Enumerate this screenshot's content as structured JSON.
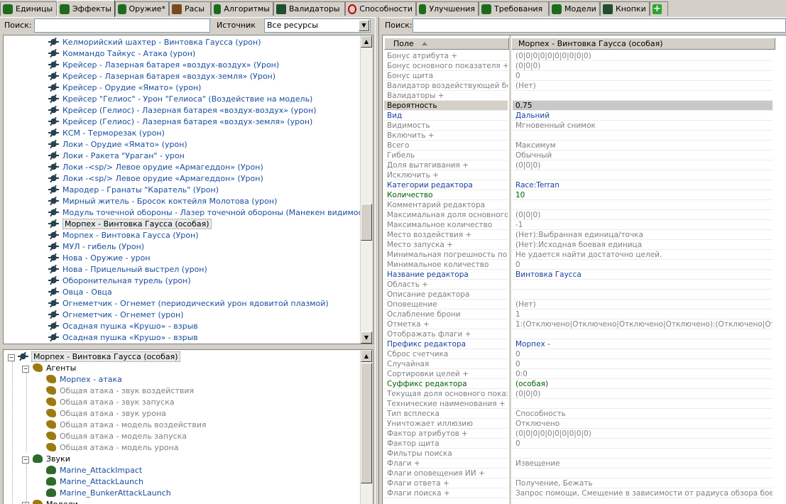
{
  "tabs": [
    {
      "label": "Единицы",
      "icon": "unit-icon"
    },
    {
      "label": "Эффекты",
      "icon": "effect-icon"
    },
    {
      "label": "Оружие*",
      "icon": "weapon-icon"
    },
    {
      "label": "Расы",
      "icon": "race-icon"
    },
    {
      "label": "Алгоритмы",
      "icon": "behavior-icon"
    },
    {
      "label": "Валидаторы",
      "icon": "validator-icon"
    },
    {
      "label": "Способности",
      "icon": "ability-icon"
    },
    {
      "label": "Улучшения",
      "icon": "upgrade-icon"
    },
    {
      "label": "Требования",
      "icon": "requirement-icon"
    },
    {
      "label": "Модели",
      "icon": "model-icon"
    },
    {
      "label": "Кнопки",
      "icon": "button-icon"
    },
    {
      "label": "",
      "icon": "add-tab-icon"
    }
  ],
  "left_search": {
    "label": "Поиск:",
    "value": ""
  },
  "source": {
    "label": "Источник",
    "value": "Все ресурсы"
  },
  "right_search": {
    "label": "Поиск:",
    "value": ""
  },
  "effect_list": [
    "Келморийский шахтер - Винтовка Гаусса (урон)",
    "Коммандо Тайкус - Атака (урон)",
    "Крейсер - Лазерная батарея «воздух-воздух» (Урон)",
    "Крейсер - Лазерная батарея «воздух-земля» (Урон)",
    "Крейсер - Орудие «Ямато» (урон)",
    "Крейсер \"Гелиос\" - Урон \"Гелиоса\" (Воздействие на модель)",
    "Крейсер (Гелиос) - Лазерная батарея «воздух-воздух» (урон)",
    "Крейсер (Гелиос) - Лазерная батарея «воздух-земля» (урон)",
    "КСМ - Терморезак (урон)",
    "Локи - Орудие «Ямато» (урон)",
    "Локи - Ракета \"Ураган\" - урон",
    "Локи -<sp/> Левое орудие «Армагеддон» (Урон)",
    "Локи -<sp/> Левое орудие «Армагеддон» (Урон)",
    "Мародер - Гранаты \"Каратель\" (Урон)",
    "Мирный житель - Бросок коктейля Молотова (урон)",
    "Модуль точечной обороны - Лазер точечной обороны (Манекен видимости)",
    "Морпех - Винтовка Гаусса (особая)",
    "Морпех - Винтовка Гаусса (Урон)",
    "МУЛ - гибель (Урон)",
    "Нова - Оружие - урон",
    "Нова - Прицельный выстрел (урон)",
    "Оборонительная турель (урон)",
    "Овца - Овца",
    "Огнеметчик - Огнемет (периодический урон ядовитой плазмой)",
    "Огнеметчик - Огнемет (урон)",
    "Осадная пушка «Крушо» - взрыв",
    "Осадная пушка «Крушо» - взрыв"
  ],
  "selected_effect_index": 16,
  "tree": {
    "root": "Морпех - Винтовка Гаусса (особая)",
    "agents_label": "Агенты",
    "agents": [
      {
        "label": "Морпех - атака",
        "active": true
      },
      {
        "label": "Общая атака - звук воздействия",
        "active": false
      },
      {
        "label": "Общая атака - звук запуска",
        "active": false
      },
      {
        "label": "Общая атака - звук урона",
        "active": false
      },
      {
        "label": "Общая атака - модель воздействия",
        "active": false
      },
      {
        "label": "Общая атака - модель запуска",
        "active": false
      },
      {
        "label": "Общая атака - модель урона",
        "active": false
      }
    ],
    "sounds_label": "Звуки",
    "sounds": [
      "Marine_AttackImpact",
      "Marine_AttackLaunch",
      "Marine_BunkerAttackLaunch"
    ],
    "models_label": "Модели"
  },
  "grid": {
    "col_field": "Поле",
    "col_value": "Морпех - Винтовка Гаусса (особая)",
    "rows": [
      {
        "name": "Бонус атрибута +",
        "value": "(0|0|0|0|0|0|0|0|0|0)",
        "style": "grey"
      },
      {
        "name": "Бонус основного показателя +",
        "value": "(0|0|0)",
        "style": "grey"
      },
      {
        "name": "Бонус щита",
        "value": "0",
        "style": "grey"
      },
      {
        "name": "Валидатор воздействующей боевой единицы",
        "value": "(Нет)",
        "style": "grey"
      },
      {
        "name": "Валидаторы +",
        "value": "",
        "style": "grey"
      },
      {
        "name": "Вероятность",
        "value": "0.75",
        "style": "hl"
      },
      {
        "name": "Вид",
        "value": "Дальний",
        "style": "blue"
      },
      {
        "name": "Видимость",
        "value": "Мгновенный снимок",
        "style": "grey"
      },
      {
        "name": "Включить +",
        "value": "",
        "style": "grey"
      },
      {
        "name": "Всего",
        "value": "Максимум",
        "style": "grey"
      },
      {
        "name": "Гибель",
        "value": "Обычный",
        "style": "grey"
      },
      {
        "name": "Доля вытягивания +",
        "value": "(0|0|0)",
        "style": "grey"
      },
      {
        "name": "Исключить +",
        "value": "",
        "style": "grey"
      },
      {
        "name": "Категории редактора",
        "value": "Race:Terran",
        "style": "blue"
      },
      {
        "name": "Количество",
        "value": "10",
        "style": "green"
      },
      {
        "name": "Комментарий редактора",
        "value": "",
        "style": "grey"
      },
      {
        "name": "Максимальная доля основного показателя",
        "value": "(0|0|0)",
        "style": "grey"
      },
      {
        "name": "Максимальное количество",
        "value": "-1",
        "style": "grey"
      },
      {
        "name": "Место воздействия +",
        "value": "(Нет):Выбранная единица/точка",
        "style": "grey"
      },
      {
        "name": "Место запуска +",
        "value": "(Нет):Исходная боевая единица",
        "style": "grey"
      },
      {
        "name": "Минимальная погрешность подсчета",
        "value": "Не удается найти достаточно целей.",
        "style": "grey"
      },
      {
        "name": "Минимальное количество",
        "value": "0",
        "style": "grey"
      },
      {
        "name": "Название редактора",
        "value": "Винтовка Гаусса",
        "style": "blue"
      },
      {
        "name": "Область +",
        "value": "",
        "style": "grey"
      },
      {
        "name": "Описание редактора",
        "value": "",
        "style": "grey"
      },
      {
        "name": "Оповещение",
        "value": "(Нет)",
        "style": "grey"
      },
      {
        "name": "Ослабление брони",
        "value": "1",
        "style": "grey"
      },
      {
        "name": "Отметка +",
        "value": "1:(Отключено|Отключено|Отключено|Отключено):(Отключено|Отключено|Отключено|Отключено)",
        "style": "grey"
      },
      {
        "name": "Отображать флаги +",
        "value": "",
        "style": "grey"
      },
      {
        "name": "Префикс редактора",
        "value": "Морпех -",
        "style": "blue"
      },
      {
        "name": "Сброс счетчика",
        "value": "0",
        "style": "grey"
      },
      {
        "name": "Случайная",
        "value": "0",
        "style": "grey"
      },
      {
        "name": "Сортировки целей +",
        "value": "0:0",
        "style": "grey"
      },
      {
        "name": "Суффикс редактора",
        "value": "(особая)",
        "style": "green"
      },
      {
        "name": "Текущая доля основного показателя",
        "value": "(0|0|0)",
        "style": "grey"
      },
      {
        "name": "Технические наименования +",
        "value": "",
        "style": "grey"
      },
      {
        "name": "Тип всплеска",
        "value": "Способность",
        "style": "grey"
      },
      {
        "name": "Уничтожает иллюзию",
        "value": "Отключено",
        "style": "grey"
      },
      {
        "name": "Фактор атрибутов +",
        "value": "(0|0|0|0|0|0|0|0|0|0)",
        "style": "grey"
      },
      {
        "name": "Фактор щита",
        "value": "0",
        "style": "grey"
      },
      {
        "name": "Фильтры поиска",
        "value": "",
        "style": "grey"
      },
      {
        "name": "Флаги +",
        "value": "Извещение",
        "style": "grey"
      },
      {
        "name": "Флаги оповещения ИИ +",
        "value": "",
        "style": "grey"
      },
      {
        "name": "Флаги ответа +",
        "value": "Получение, Бежать",
        "style": "grey"
      },
      {
        "name": "Флаги поиска +",
        "value": "Запрос помощи, Смещение в зависимости от радиуса обзора боевой единицы",
        "style": "grey"
      }
    ]
  }
}
